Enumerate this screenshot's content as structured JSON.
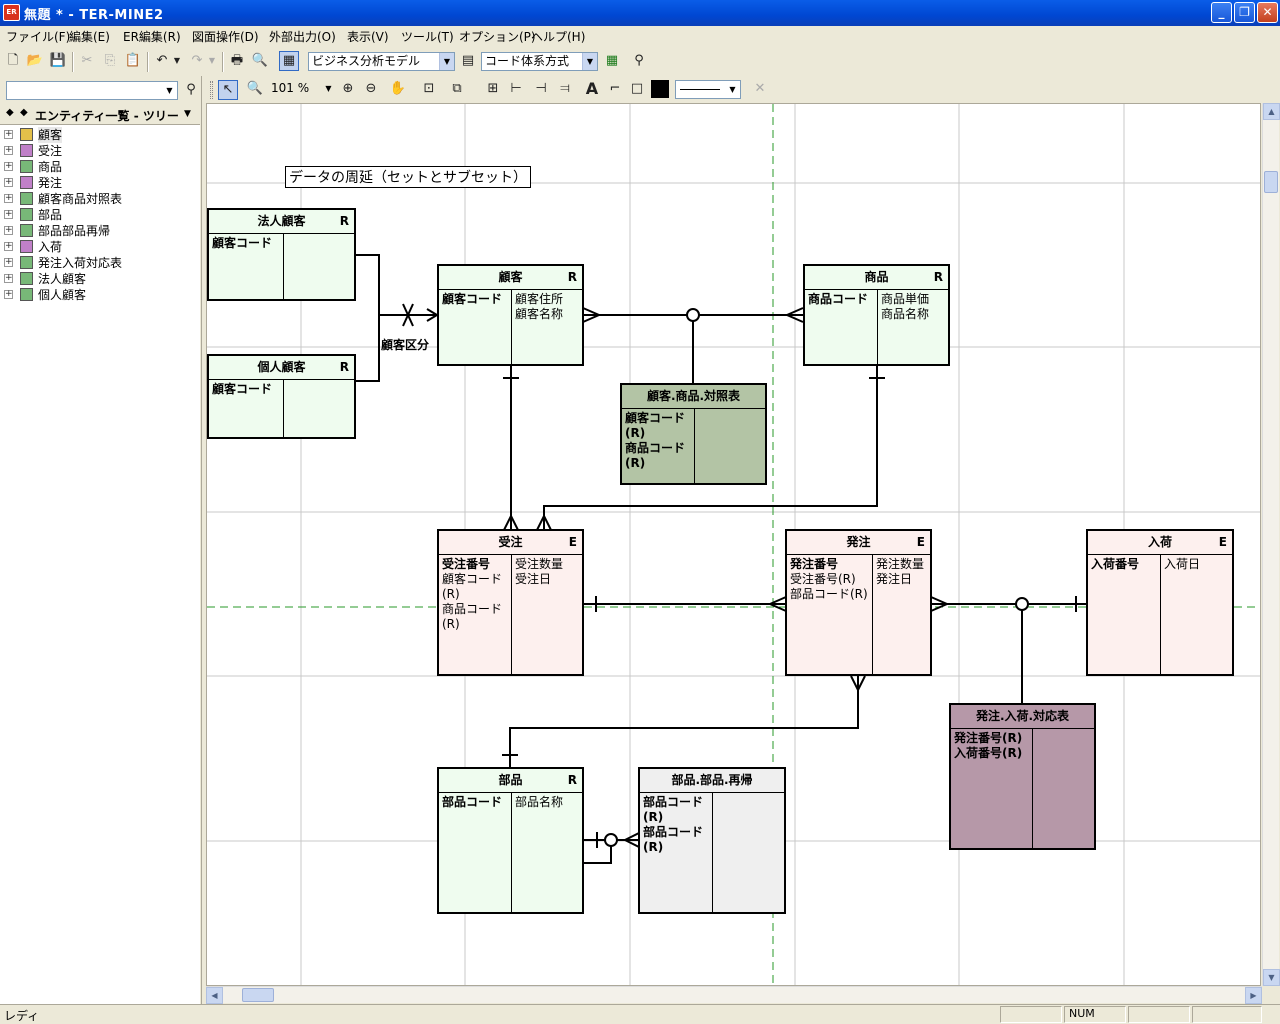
{
  "window": {
    "app_icon": "ER",
    "title": "無題 * - TER-MINE2",
    "buttons": {
      "minimize": "_",
      "restore": "❐",
      "close": "✕"
    }
  },
  "menu": [
    "ファイル(F)",
    "編集(E)",
    "ER編集(R)",
    "図面操作(D)",
    "外部出力(O)",
    "表示(V)",
    "ツール(T)",
    "オプション(P)",
    "ヘルプ(H)"
  ],
  "toolbar": {
    "model_select": "ビジネス分析モデル",
    "code_select": "コード体系方式",
    "zoom": "101 %"
  },
  "panel": {
    "title": "エンティティ一覧 - ツリー",
    "search_value": "",
    "items": [
      {
        "label": "顧客",
        "color": "#e3c04a"
      },
      {
        "label": "受注",
        "color": "#c080c8"
      },
      {
        "label": "商品",
        "color": "#78b878"
      },
      {
        "label": "発注",
        "color": "#c080c8"
      },
      {
        "label": "顧客商品対照表",
        "color": "#78b878"
      },
      {
        "label": "部品",
        "color": "#78b878"
      },
      {
        "label": "部品部品再帰",
        "color": "#78b878"
      },
      {
        "label": "入荷",
        "color": "#c080c8"
      },
      {
        "label": "発注入荷対応表",
        "color": "#78b878"
      },
      {
        "label": "法人顧客",
        "color": "#78b878"
      },
      {
        "label": "個人顧客",
        "color": "#78b878"
      }
    ]
  },
  "diagram": {
    "note": "データの周延（セットとサブセット）",
    "relation_label": "顧客区分",
    "entities": {
      "hojin": {
        "name": "法人顧客",
        "kind": "R",
        "keys": "顧客コード",
        "attrs": ""
      },
      "kojin": {
        "name": "個人顧客",
        "kind": "R",
        "keys": "顧客コード",
        "attrs": ""
      },
      "kokyaku": {
        "name": "顧客",
        "kind": "R",
        "keys": "顧客コード",
        "attrs": "顧客住所\n顧客名称"
      },
      "shohin": {
        "name": "商品",
        "kind": "R",
        "keys": "商品コード",
        "attrs": "商品単価\n商品名称"
      },
      "taisho": {
        "name": "顧客.商品.対照表",
        "kind": "",
        "keys": "顧客コード\n(R)\n商品コード\n(R)",
        "attrs": ""
      },
      "juchu": {
        "name": "受注",
        "kind": "E",
        "keys": "受注番号",
        "fks": "顧客コード\n(R)\n商品コード\n(R)",
        "attrs": "受注数量\n受注日"
      },
      "hatchu": {
        "name": "発注",
        "kind": "E",
        "keys": "発注番号",
        "fks": "受注番号(R)\n部品コード(R)",
        "attrs": "発注数量\n発注日"
      },
      "nyuka": {
        "name": "入荷",
        "kind": "E",
        "keys": "入荷番号",
        "attrs": "入荷日"
      },
      "taiou": {
        "name": "発注.入荷.対応表",
        "kind": "",
        "keys": "発注番号(R)\n入荷番号(R)",
        "attrs": ""
      },
      "buhin": {
        "name": "部品",
        "kind": "R",
        "keys": "部品コード",
        "attrs": "部品名称"
      },
      "saiki": {
        "name": "部品.部品.再帰",
        "kind": "",
        "keys": "部品コード\n(R)\n部品コード\n(R)",
        "attrs": ""
      }
    }
  },
  "status": {
    "text": "レディ",
    "num": "NUM"
  }
}
